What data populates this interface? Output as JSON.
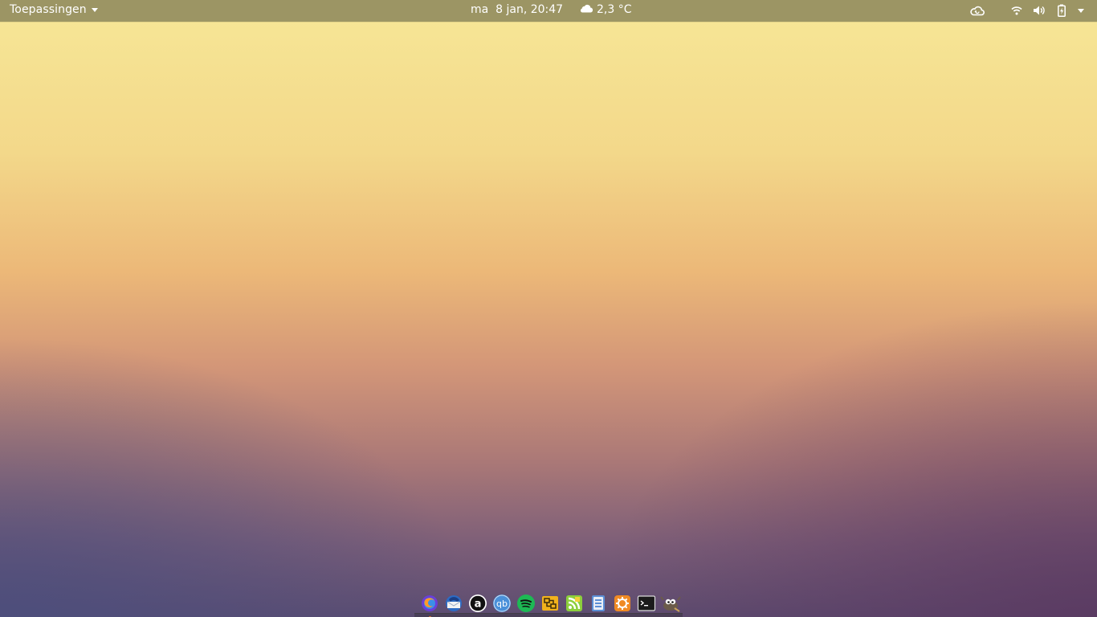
{
  "topbar": {
    "apps_menu_label": "Toepassingen",
    "clock": "ma  8 jan, 20:47",
    "weather": {
      "icon": "cloud-icon",
      "temperature": "2,3 °C"
    },
    "tray_icons": [
      "cloud-sync-icon",
      "wifi-icon",
      "volume-icon",
      "battery-charging-icon",
      "system-menu-arrow-icon"
    ]
  },
  "dock": {
    "items": [
      {
        "name": "firefox",
        "icon": "firefox-icon"
      },
      {
        "name": "thunderbird",
        "icon": "thunderbird-icon"
      },
      {
        "name": "amazon",
        "icon": "amazon-icon"
      },
      {
        "name": "qbittorrent",
        "icon": "qbittorrent-icon"
      },
      {
        "name": "spotify",
        "icon": "spotify-icon"
      },
      {
        "name": "network-app",
        "icon": "network-icon"
      },
      {
        "name": "rss-reader",
        "icon": "rss-icon"
      },
      {
        "name": "files",
        "icon": "files-icon"
      },
      {
        "name": "settings",
        "icon": "settings-icon"
      },
      {
        "name": "terminal",
        "icon": "terminal-icon"
      },
      {
        "name": "gimp",
        "icon": "gimp-icon"
      }
    ]
  },
  "colors": {
    "topbar_bg": "#9c9564",
    "topbar_text": "#ffffff",
    "wallpaper_top": "#f6e595",
    "wallpaper_bottom": "#5c4c70"
  }
}
